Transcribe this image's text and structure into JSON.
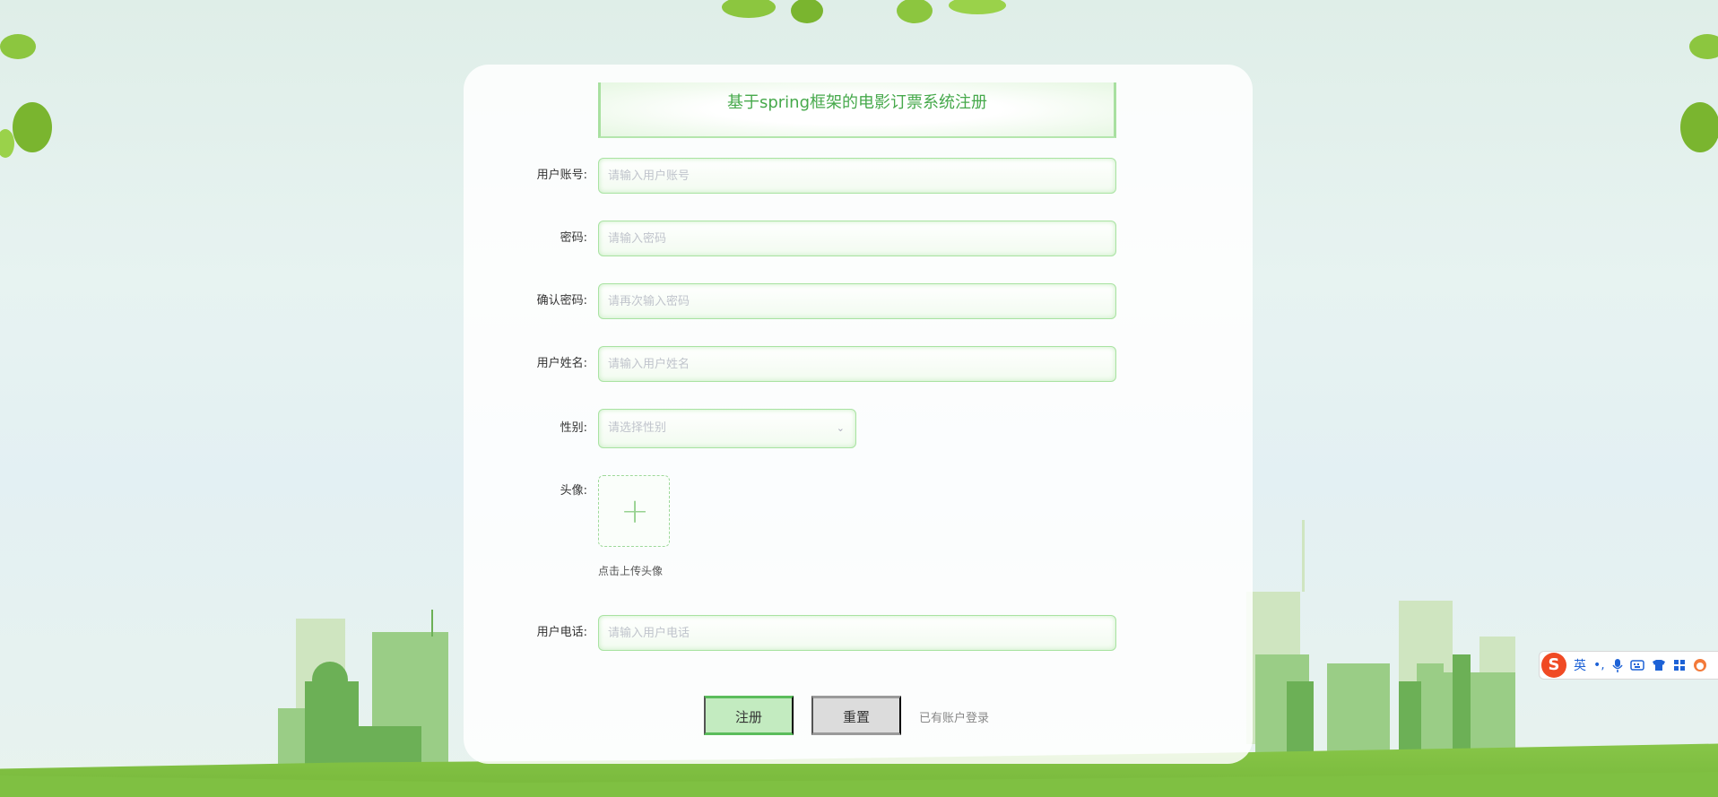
{
  "form": {
    "title": "基于spring框架的电影订票系统注册",
    "fields": [
      {
        "label": "用户账号:",
        "placeholder": "请输入用户账号"
      },
      {
        "label": "密码:",
        "placeholder": "请输入密码"
      },
      {
        "label": "确认密码:",
        "placeholder": "请再次输入密码"
      },
      {
        "label": "用户姓名:",
        "placeholder": "请输入用户姓名"
      }
    ],
    "gender": {
      "label": "性别:",
      "placeholder": "请选择性别"
    },
    "avatar": {
      "label": "头像:",
      "hint": "点击上传头像"
    },
    "phone": {
      "label": "用户电话:",
      "placeholder": "请输入用户电话"
    },
    "buttons": {
      "register": "注册",
      "reset": "重置"
    },
    "login_link": "已有账户登录"
  },
  "ime": {
    "lang": "英",
    "punct": "•,",
    "icons": [
      "sogou-logo-icon",
      "microphone-icon",
      "keyboard-icon",
      "skin-icon",
      "grid-icon",
      "avatar-icon"
    ]
  },
  "colors": {
    "accent": "#46a94b",
    "border": "#a9e3a2",
    "grass": "#7fc042"
  }
}
